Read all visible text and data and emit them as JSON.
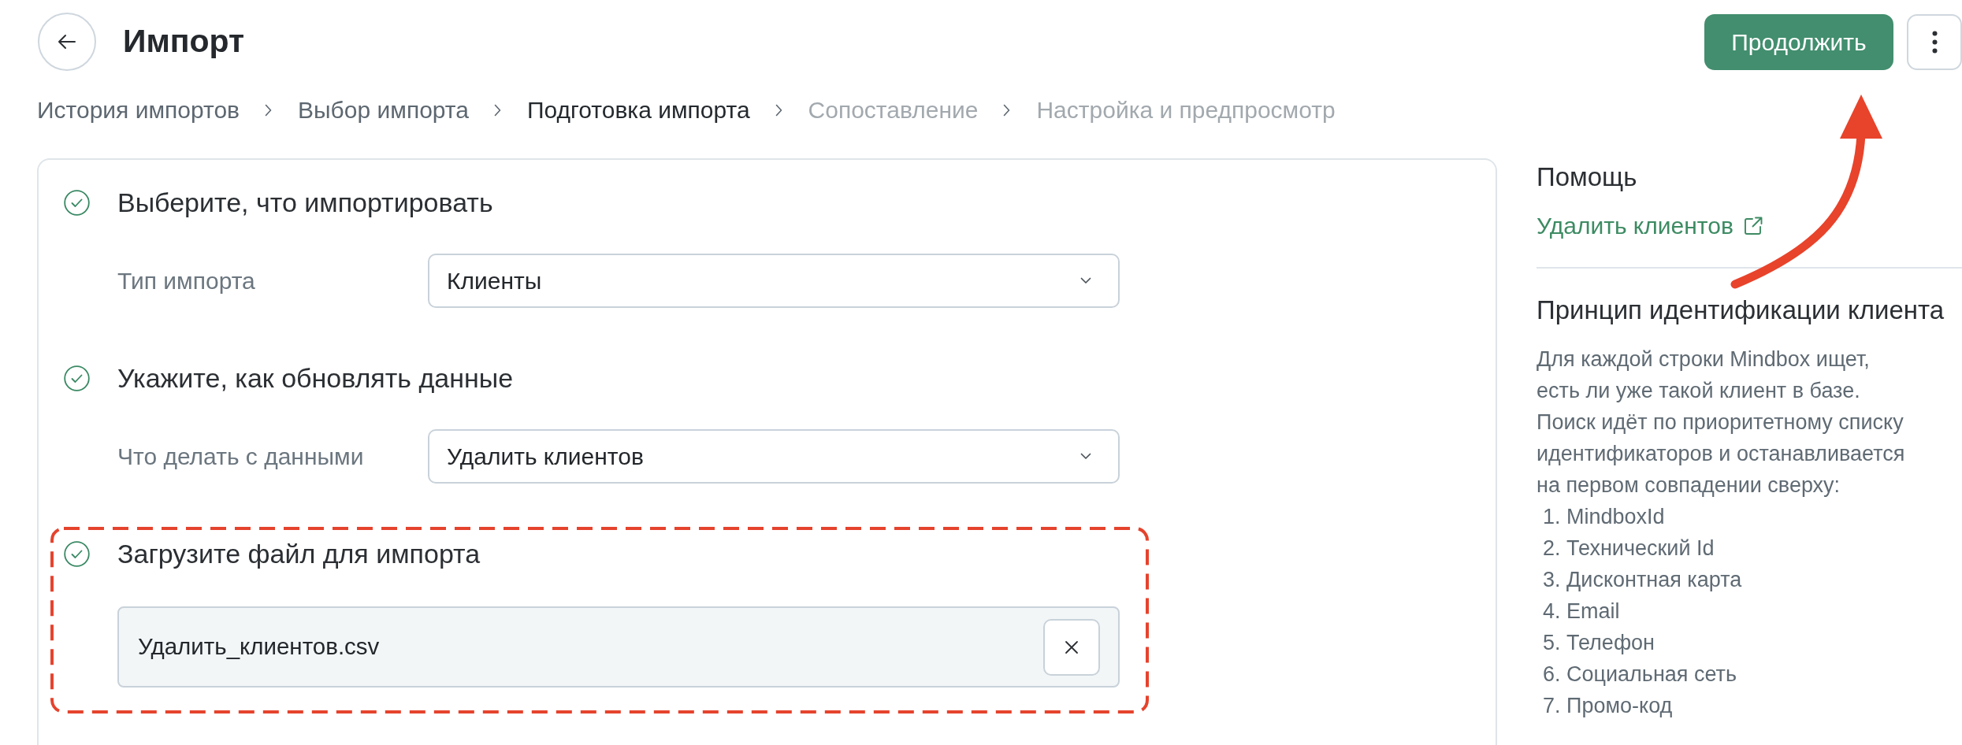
{
  "header": {
    "title": "Импорт",
    "continue_button": {
      "label": "Продолжить",
      "highlighted": true
    }
  },
  "breadcrumbs": [
    {
      "label": "История импортов",
      "selected": false,
      "disabled": false
    },
    {
      "label": "Выбор импорта",
      "selected": false,
      "disabled": false
    },
    {
      "label": "Подготовка импорта",
      "selected": true,
      "disabled": false
    },
    {
      "label": "Сопоставление",
      "selected": false,
      "disabled": true
    },
    {
      "label": "Настройка и предпросмотр",
      "selected": false,
      "disabled": true
    }
  ],
  "sections": [
    {
      "kind": "select",
      "title": "Выберите, что импортировать",
      "done": true,
      "highlighted": false,
      "label": "Тип импорта",
      "value": "Клиенты"
    },
    {
      "kind": "select",
      "title": "Укажите, как обновлять данные",
      "done": true,
      "highlighted": false,
      "label": "Что делать с данными",
      "value": "Удалить клиентов"
    },
    {
      "kind": "file",
      "title": "Загрузите файл для импорта",
      "done": true,
      "highlighted": true,
      "file_name": "Удалить_клиентов.csv"
    }
  ],
  "sidebar": {
    "help_title": "Помощь",
    "help_link": "Удалить клиентов",
    "principle_title": "Принцип идентификации клиента",
    "paragraph": "Для каждой строки Mindbox ищет,\nесть ли уже такой клиент в базе.\nПоиск идёт по приоритетному списку\nидентификаторов и останавливается\nна первом совпадении сверху:",
    "list": [
      "1. MindboxId",
      "2. Технический Id",
      "3. Дисконтная карта",
      "4. Email",
      "5. Телефон",
      "6. Социальная сеть",
      "7. Промо-код"
    ]
  }
}
